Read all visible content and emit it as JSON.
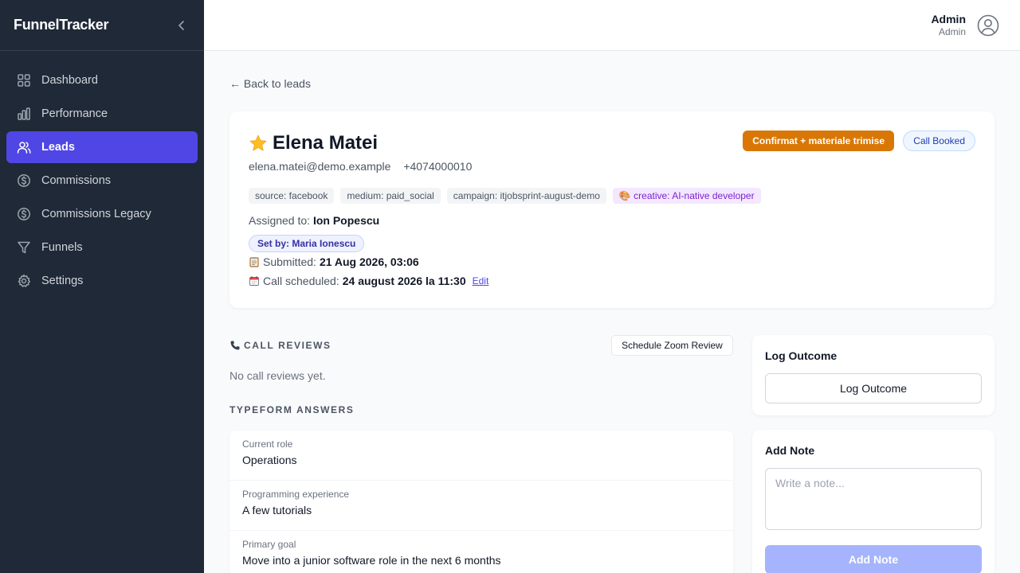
{
  "app": {
    "brand": "FunnelTracker"
  },
  "sidebar": {
    "items": [
      {
        "label": "Dashboard",
        "icon": "grid-icon"
      },
      {
        "label": "Performance",
        "icon": "bar-chart-icon"
      },
      {
        "label": "Leads",
        "icon": "users-icon",
        "active": true
      },
      {
        "label": "Commissions",
        "icon": "dollar-circle-icon"
      },
      {
        "label": "Commissions Legacy",
        "icon": "dollar-circle-icon"
      },
      {
        "label": "Funnels",
        "icon": "funnel-icon"
      },
      {
        "label": "Settings",
        "icon": "gear-icon"
      }
    ]
  },
  "user": {
    "name": "Admin",
    "role": "Admin"
  },
  "back_link": "← Back to leads",
  "lead": {
    "name": "Elena Matei",
    "email": "elena.matei@demo.example",
    "phone": "+4074000010",
    "tags": [
      "source: facebook",
      "medium: paid_social",
      "campaign: itjobsprint-august-demo",
      "🎨 creative: AI-native developer"
    ],
    "assigned_label": "Assigned to:",
    "assigned_to": "Ion Popescu",
    "set_by": "Set by: Maria Ionescu",
    "submitted_label": "Submitted:",
    "submitted": "21 Aug 2026, 03:06",
    "call_label": "Call scheduled:",
    "call": "24 august 2026 la 11:30",
    "edit_label": "Edit",
    "stage_badge": "Confirmat + materiale trimise",
    "call_badge": "Call Booked"
  },
  "call_reviews": {
    "title": "CALL REVIEWS",
    "button": "Schedule Zoom Review",
    "empty": "No call reviews yet."
  },
  "typeform": {
    "title": "TYPEFORM ANSWERS",
    "answers": [
      {
        "q": "Current role",
        "a": "Operations"
      },
      {
        "q": "Programming experience",
        "a": "A few tutorials"
      },
      {
        "q": "Primary goal",
        "a": "Move into a junior software role in the next 6 months"
      }
    ]
  },
  "log_outcome": {
    "title": "Log Outcome",
    "button": "Log Outcome"
  },
  "add_note": {
    "title": "Add Note",
    "placeholder": "Write a note...",
    "button": "Add Note"
  },
  "colors": {
    "accent": "#4f46e5",
    "sidebar": "#1f2937",
    "stage_badge": "#d97706"
  }
}
